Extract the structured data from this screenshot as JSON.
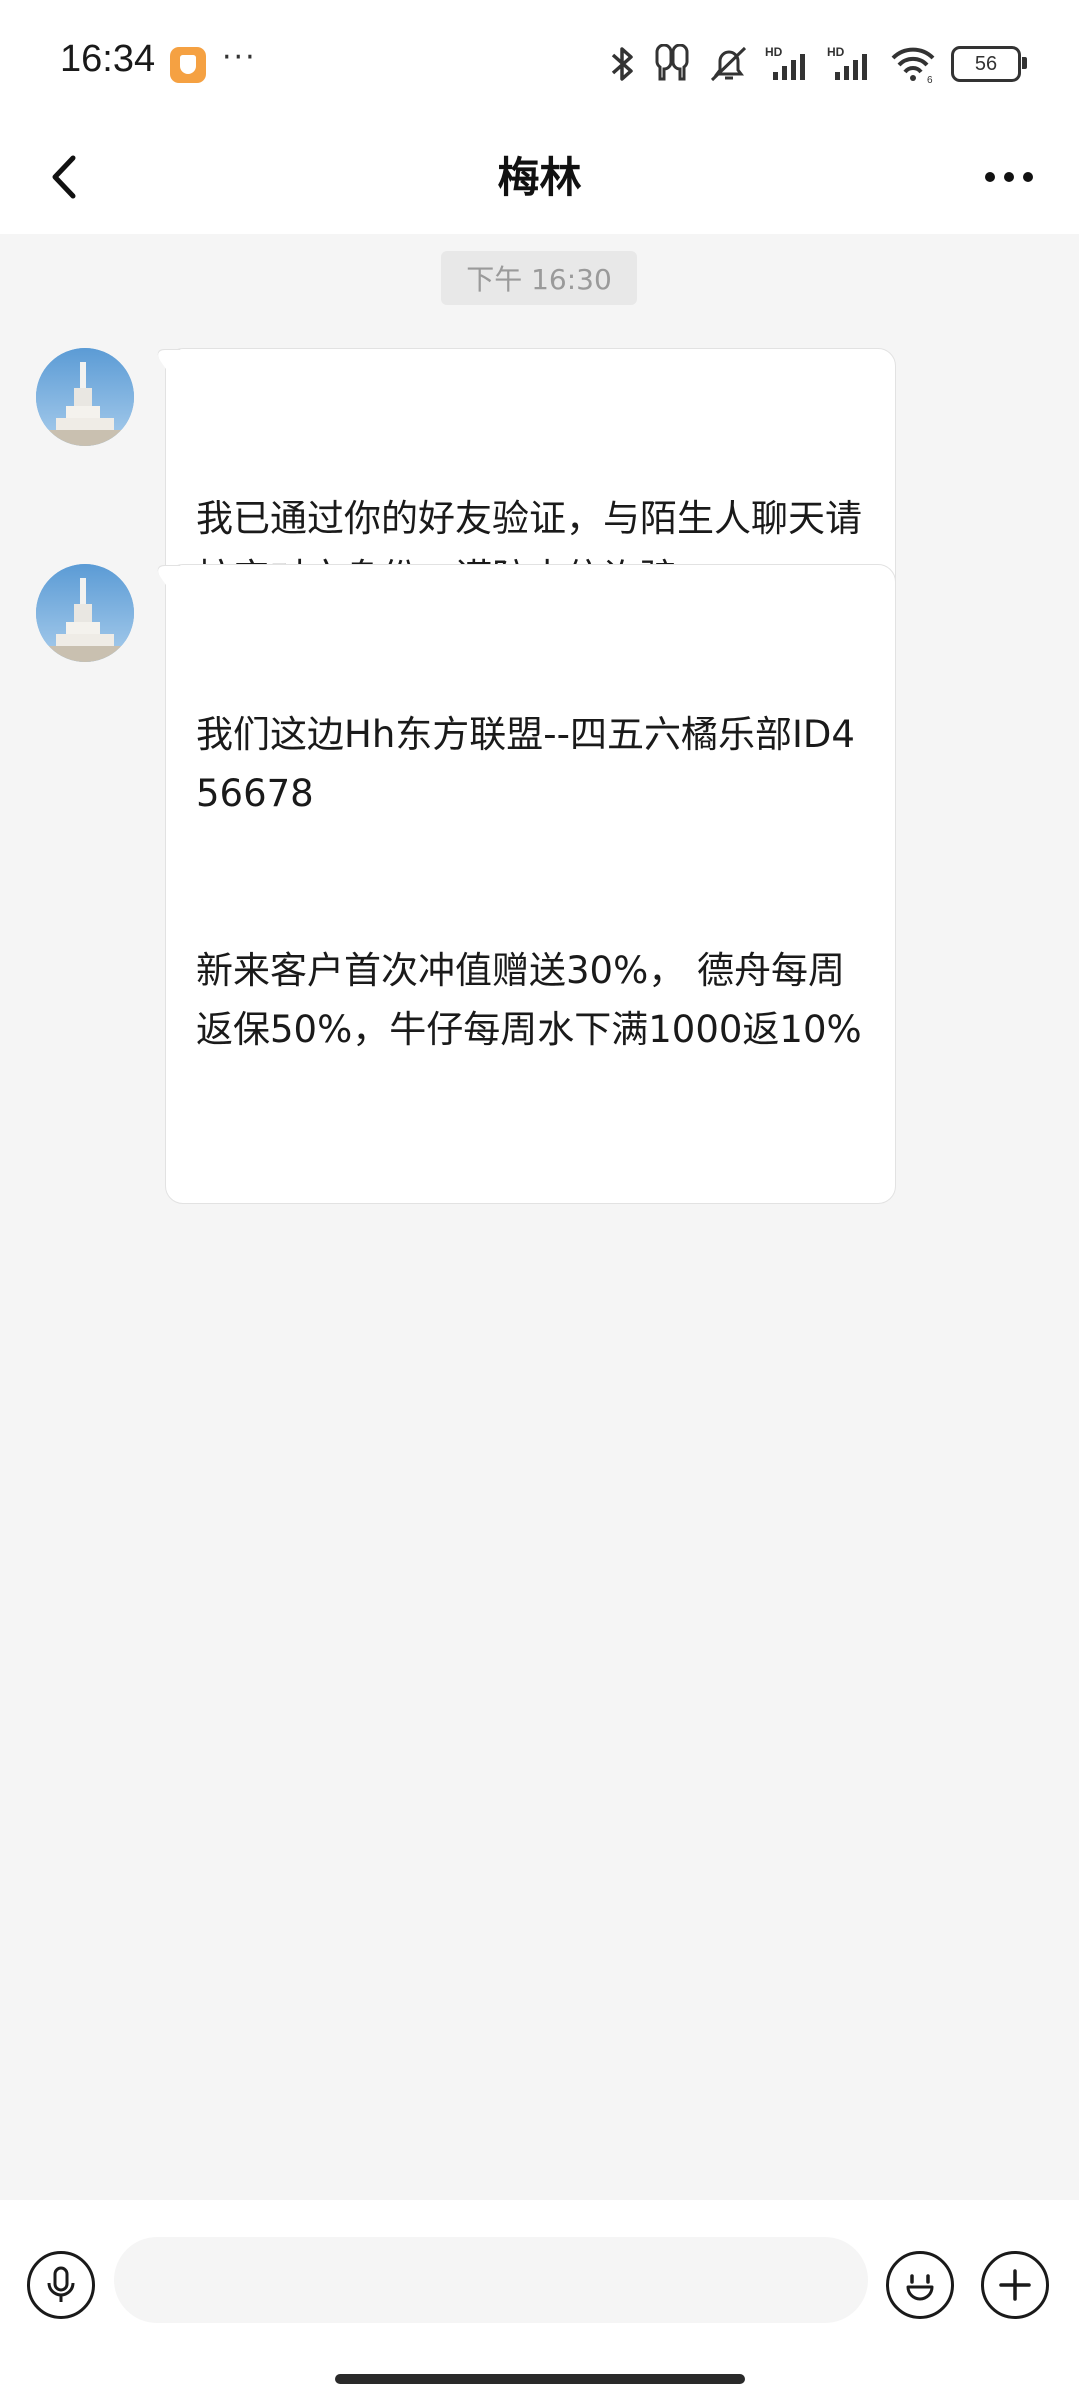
{
  "status_bar": {
    "time": "16:34",
    "more": "···",
    "battery": "56",
    "icons": [
      "bluetooth-icon",
      "earbuds-icon",
      "mute-bell-icon",
      "signal-hd-icon",
      "signal-hd-icon",
      "wifi-icon",
      "battery-icon"
    ]
  },
  "header": {
    "title": "梅林",
    "back_icon": "chevron-left-icon",
    "more_icon": "more-horizontal-icon"
  },
  "chat": {
    "timestamp": "下午 16:30",
    "messages": [
      {
        "lines": [
          "我已通过你的好友验证，与陌生人聊天请核实对方身份，谨防电信诈骗。"
        ]
      },
      {
        "lines": [
          "我们这边Hh东方联盟--四五六橘乐部ID456678",
          "新来客户首次冲值赠送30%， 德舟每周返保50%，牛仔每周水下满1000返10%"
        ]
      }
    ]
  },
  "input_bar": {
    "placeholder": "",
    "voice_icon": "microphone-icon",
    "emoji_icon": "smiley-icon",
    "add_icon": "plus-icon"
  },
  "colors": {
    "background": "#f5f5f5",
    "bubble": "#ffffff",
    "status_badge": "#f5a142"
  }
}
